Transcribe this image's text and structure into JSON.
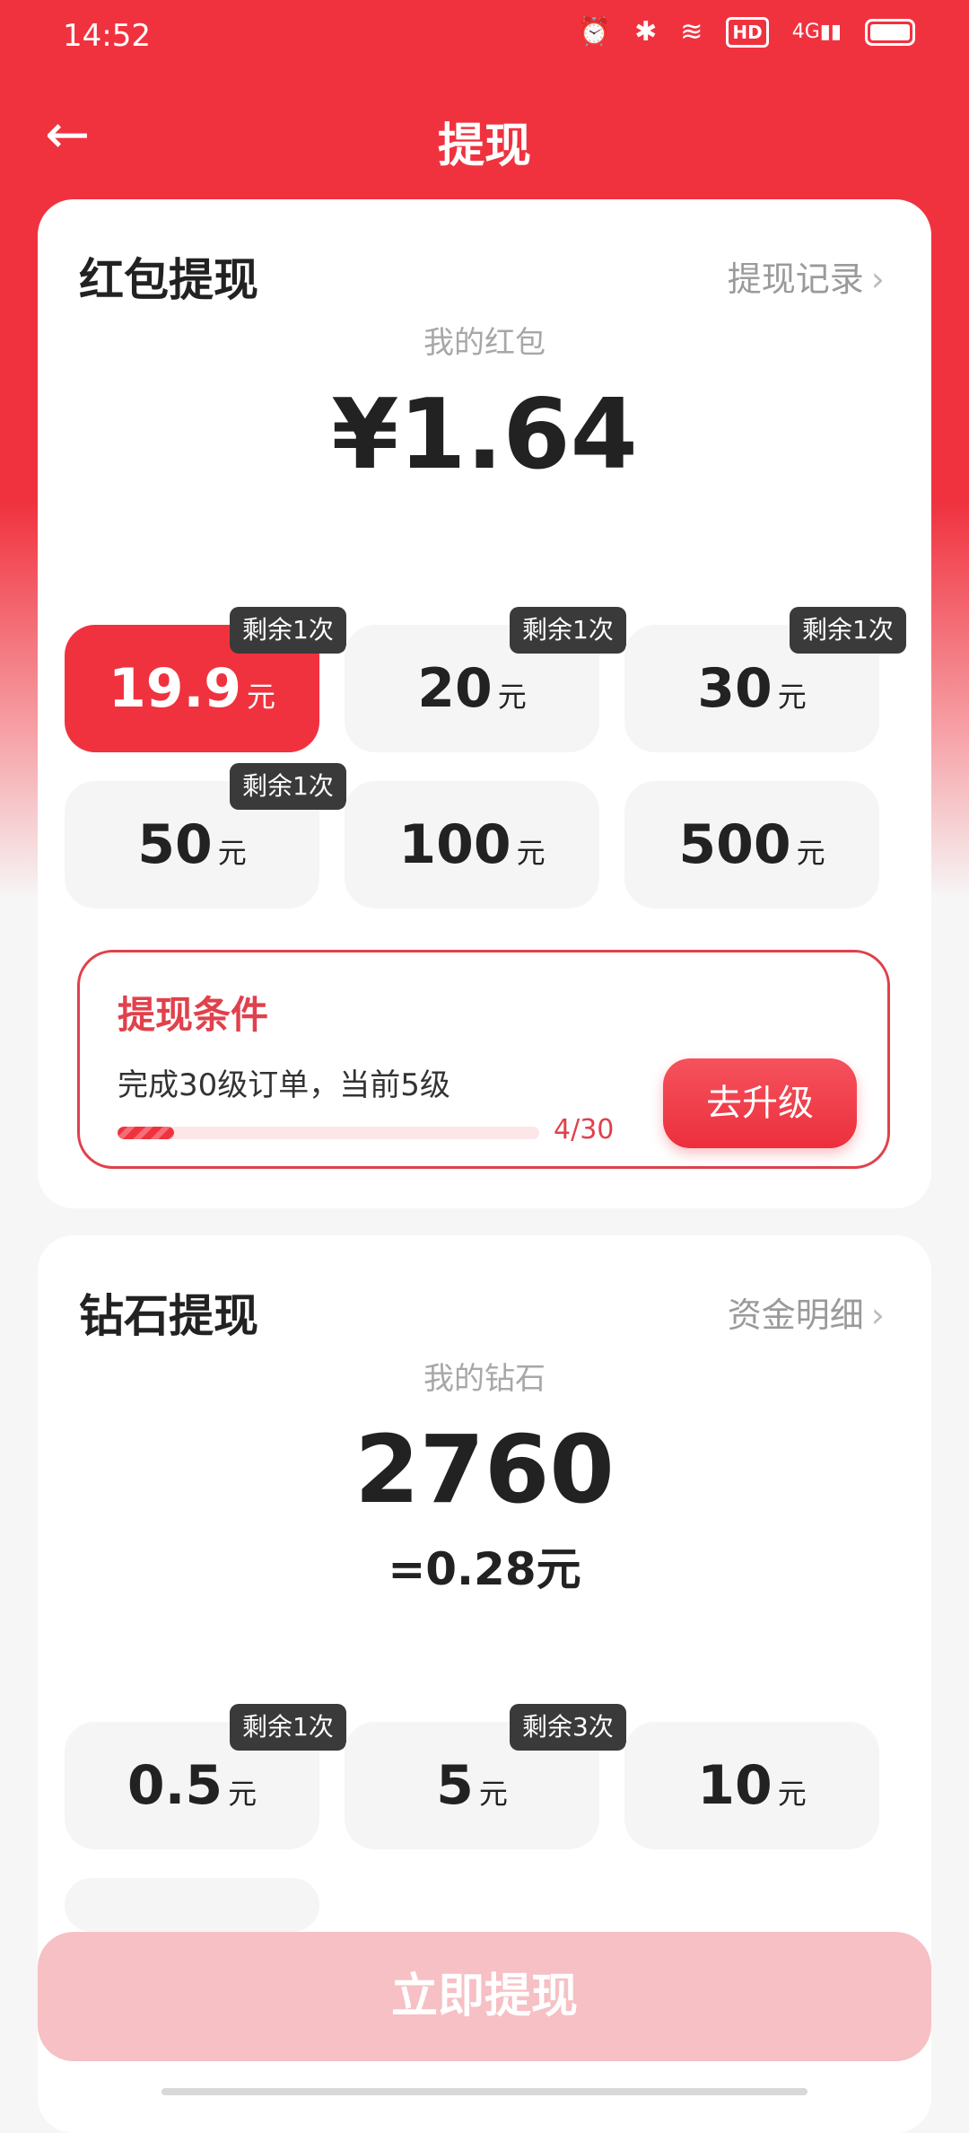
{
  "status_bar": {
    "time": "14:52",
    "hd_label": "HD",
    "network": "4G"
  },
  "nav": {
    "title": "提现",
    "back_icon": "←"
  },
  "redpacket": {
    "title": "红包提现",
    "link_label": "提现记录",
    "balance_label": "我的红包",
    "balance": "¥1.64",
    "options": [
      {
        "value": "19.9",
        "unit": "元",
        "badge": "剩余1次",
        "selected": true
      },
      {
        "value": "20",
        "unit": "元",
        "badge": "剩余1次",
        "selected": false
      },
      {
        "value": "30",
        "unit": "元",
        "badge": "剩余1次",
        "selected": false
      },
      {
        "value": "50",
        "unit": "元",
        "badge": "剩余1次",
        "selected": false
      },
      {
        "value": "100",
        "unit": "元",
        "badge": "",
        "selected": false
      },
      {
        "value": "500",
        "unit": "元",
        "badge": "",
        "selected": false
      }
    ],
    "condition": {
      "title": "提现条件",
      "description": "完成30级订单，当前5级",
      "progress_text": "4/30",
      "progress_fraction": 0.133,
      "button_label": "去升级"
    }
  },
  "diamond": {
    "title": "钻石提现",
    "link_label": "资金明细",
    "balance_label": "我的钻石",
    "balance": "2760",
    "equivalent": "=0.28元",
    "options": [
      {
        "value": "0.5",
        "unit": "元",
        "badge": "剩余1次"
      },
      {
        "value": "5",
        "unit": "元",
        "badge": "剩余3次"
      },
      {
        "value": "10",
        "unit": "元",
        "badge": ""
      }
    ]
  },
  "submit_label": "立即提现",
  "colors": {
    "primary": "#f0323f",
    "disabled_button": "#f6c0c4"
  }
}
